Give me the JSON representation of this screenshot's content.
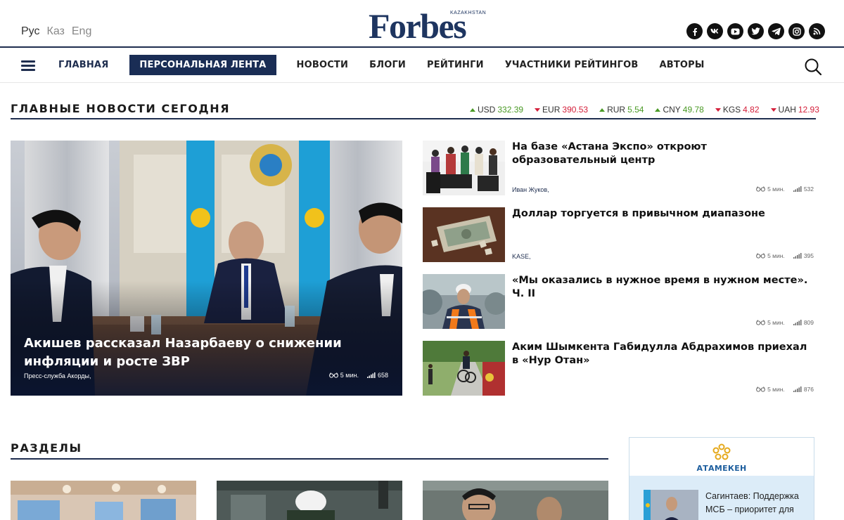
{
  "header": {
    "languages": [
      "Рус",
      "Каз",
      "Eng"
    ],
    "logo_word": "Forbes",
    "logo_sub": "KAZAKHSTAN",
    "socials": [
      "facebook-icon",
      "vk-icon",
      "youtube-icon",
      "twitter-icon",
      "telegram-icon",
      "instagram-icon",
      "rss-icon"
    ]
  },
  "nav": {
    "items": [
      "ГЛАВНАЯ",
      "ПЕРСОНАЛЬНАЯ ЛЕНТА",
      "НОВОСТИ",
      "БЛОГИ",
      "РЕЙТИНГИ",
      "УЧАСТНИКИ РЕЙТИНГОВ",
      "АВТОРЫ"
    ]
  },
  "top_news": {
    "title": "ГЛАВНЫЕ НОВОСТИ СЕГОДНЯ",
    "rates": [
      {
        "code": "USD",
        "value": "332.39",
        "trend": "up"
      },
      {
        "code": "EUR",
        "value": "390.53",
        "trend": "down"
      },
      {
        "code": "RUR",
        "value": "5.54",
        "trend": "up"
      },
      {
        "code": "CNY",
        "value": "49.78",
        "trend": "up"
      },
      {
        "code": "KGS",
        "value": "4.82",
        "trend": "down"
      },
      {
        "code": "UAH",
        "value": "12.93",
        "trend": "down"
      }
    ],
    "featured": {
      "title": "Акишев рассказал Назарбаеву о снижении инфляции и росте ЗВР",
      "author": "Пресс-служба Акорды,",
      "read_time": "5 мин.",
      "views": "658"
    },
    "side": [
      {
        "title": "На базе «Астана Экспо» откроют образовательный центр",
        "author": "Иван Жуков,",
        "read_time": "5 мин.",
        "views": "532"
      },
      {
        "title": "Доллар торгуется в привычном диапазоне",
        "author": "KASE,",
        "read_time": "5 мин.",
        "views": "395"
      },
      {
        "title": "«Мы оказались в нужное время в нужном месте». Ч. II",
        "author": "",
        "read_time": "5 мин.",
        "views": "809"
      },
      {
        "title": "Аким Шымкента Габидулла Абдрахимов приехал в «Нур Отан»",
        "author": "",
        "read_time": "5 мин.",
        "views": "876"
      }
    ]
  },
  "sections": {
    "title": "РАЗДЕЛЫ"
  },
  "ad": {
    "brand": "АТАМЕКЕН",
    "text": "Сагинтаев: Поддержка МСБ – приоритет для"
  },
  "colors": {
    "navy": "#1f2e4f",
    "up": "#4a9a25",
    "down": "#d4203b"
  }
}
